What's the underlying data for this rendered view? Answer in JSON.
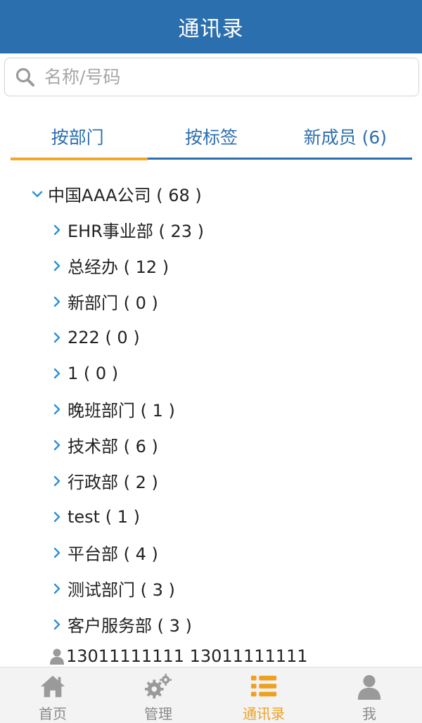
{
  "header": {
    "title": "通讯录"
  },
  "search": {
    "placeholder": "名称/号码",
    "value": ""
  },
  "tabs": [
    {
      "label": "按部门",
      "active": true
    },
    {
      "label": "按标签",
      "active": false
    },
    {
      "label": "新成员 (6)",
      "active": false
    }
  ],
  "tree": {
    "root": {
      "label": "中国AAA公司 ( 68 )",
      "expanded": true
    },
    "children": [
      {
        "label": "EHR事业部 ( 23 )"
      },
      {
        "label": "总经办 ( 12 )"
      },
      {
        "label": "新部门 ( 0 )"
      },
      {
        "label": "222 ( 0 )"
      },
      {
        "label": "1 ( 0 )"
      },
      {
        "label": "晚班部门 ( 1 )"
      },
      {
        "label": "技术部 ( 6 )"
      },
      {
        "label": "行政部 ( 2 )"
      },
      {
        "label": "test ( 1 )"
      },
      {
        "label": "平台部 ( 4 )"
      },
      {
        "label": "测试部门 ( 3 )"
      },
      {
        "label": "客户服务部 ( 3 )"
      }
    ],
    "person": {
      "label": "13011111111 13011111111"
    }
  },
  "bottom_nav": [
    {
      "label": "首页",
      "icon": "home-icon"
    },
    {
      "label": "管理",
      "icon": "gears-icon"
    },
    {
      "label": "通讯录",
      "icon": "list-icon",
      "active": true
    },
    {
      "label": "我",
      "icon": "user-icon"
    }
  ],
  "colors": {
    "primary": "#2c6fae",
    "accent": "#f5a623",
    "nav_active": "#f0a020",
    "nav_inactive": "#8a8a8a"
  }
}
